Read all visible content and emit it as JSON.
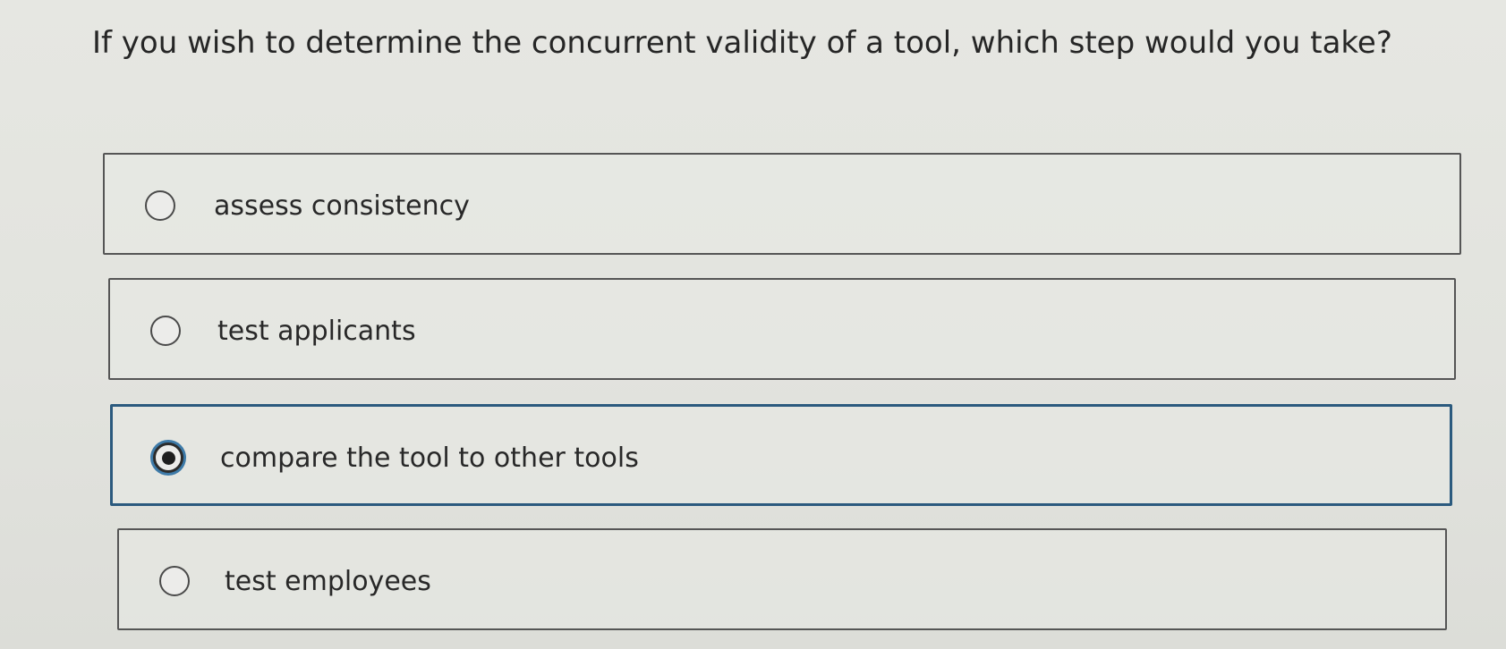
{
  "question": "If you wish to determine the concurrent validity of a tool, which step would you take?",
  "options": [
    {
      "label": "assess consistency",
      "selected": false
    },
    {
      "label": "test applicants",
      "selected": false
    },
    {
      "label": "compare the tool to other tools",
      "selected": true
    },
    {
      "label": "test employees",
      "selected": false
    }
  ],
  "colors": {
    "selected_border": "#2b5a7e",
    "selected_ring": "#3d7aa8"
  }
}
